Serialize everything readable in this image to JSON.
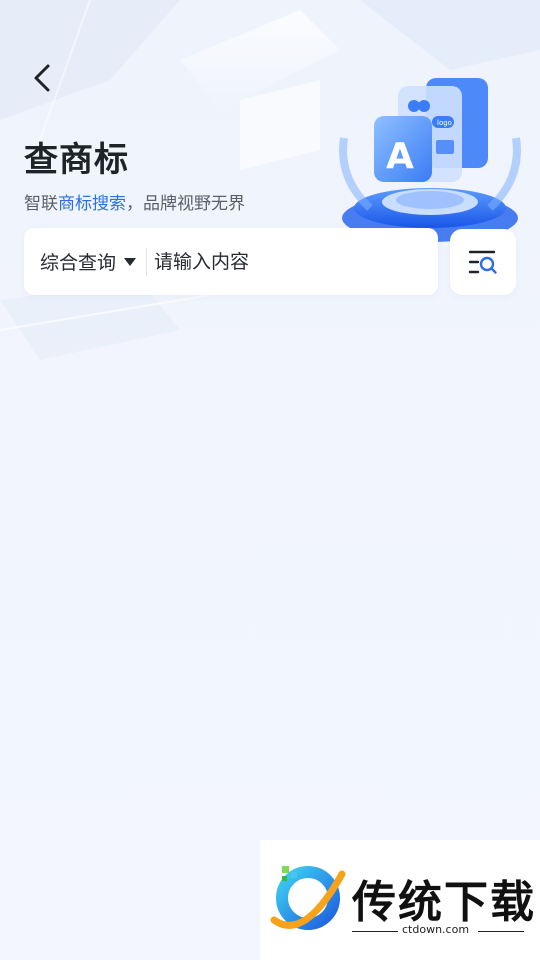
{
  "header": {
    "back_icon": "chevron-left-icon",
    "title": "查商标",
    "subtitle_prefix": "智联",
    "subtitle_highlight": "商标搜索",
    "subtitle_suffix": "，品牌视野无界"
  },
  "colors": {
    "accent": "#2f6ee3",
    "title": "#1f2329",
    "background": "#f2f5fd"
  },
  "search": {
    "type_label": "综合查询",
    "type_icon": "caret-down-icon",
    "placeholder": "请输入内容",
    "filter_icon": "list-search-icon"
  },
  "hero": {
    "badge_letter": "A",
    "card_text": "logo"
  },
  "watermark": {
    "name": "传统下载",
    "url": "ctdown.com"
  }
}
